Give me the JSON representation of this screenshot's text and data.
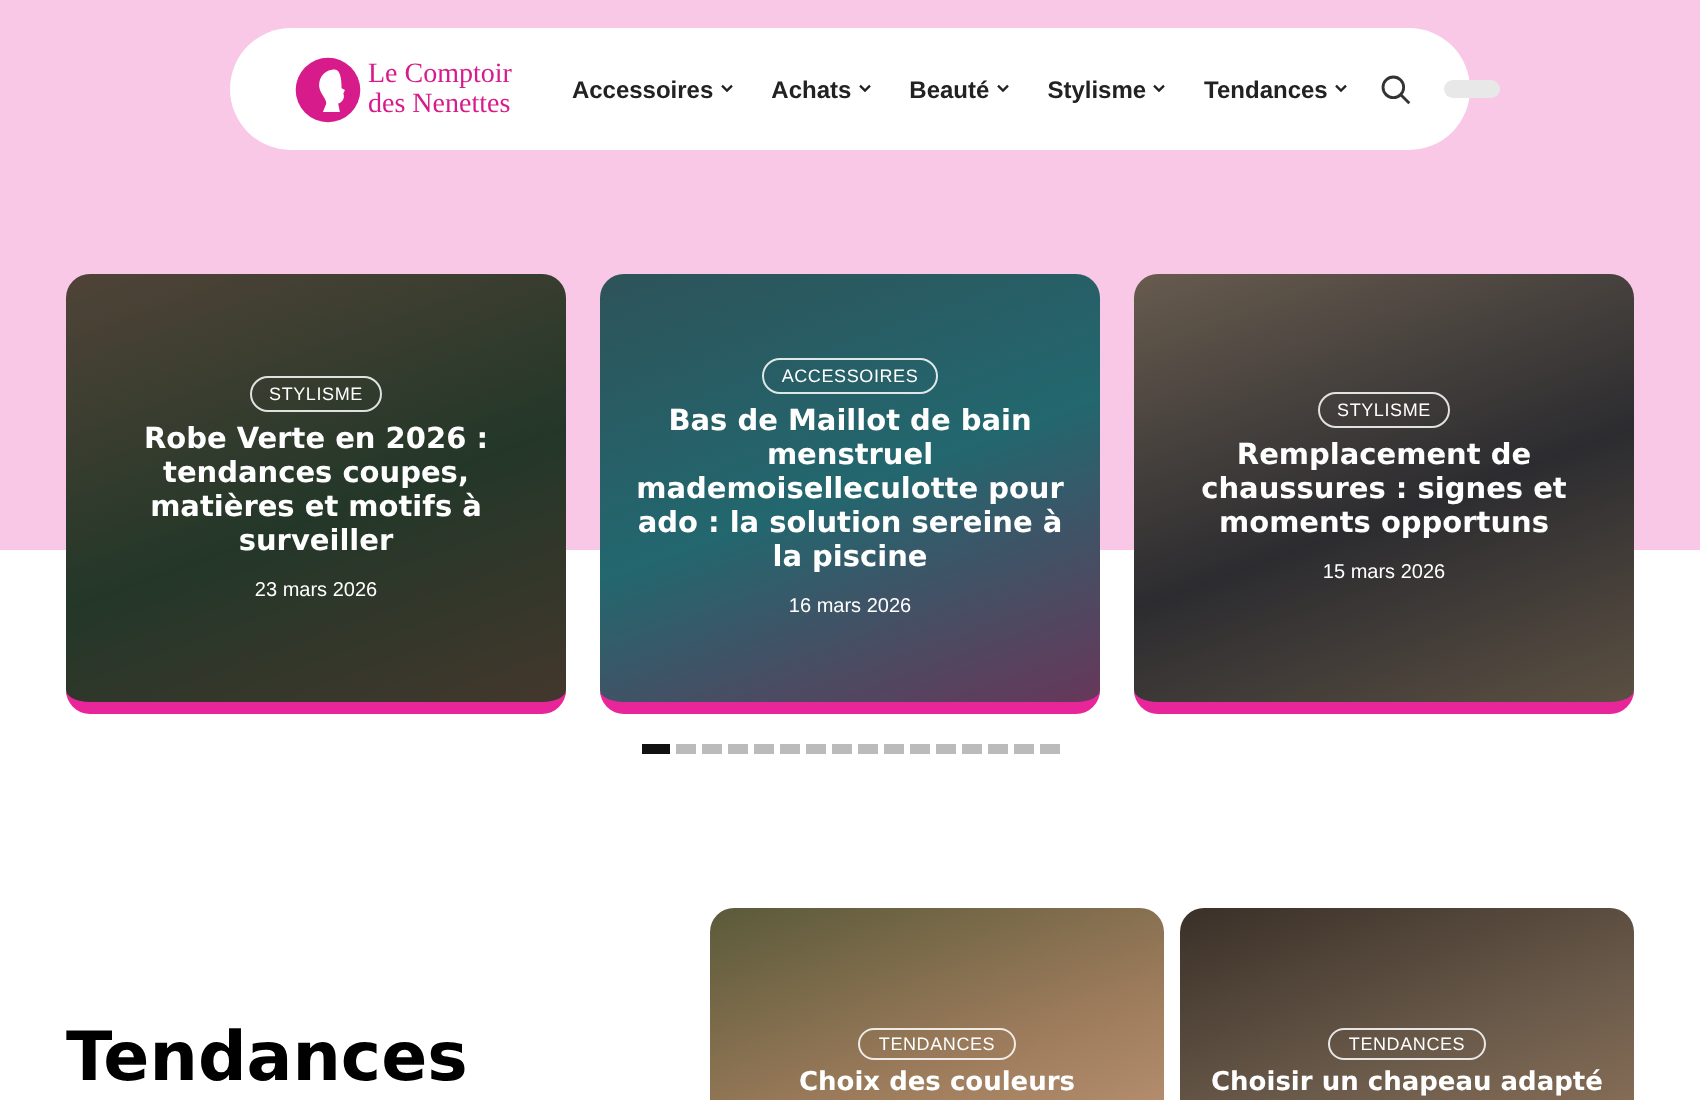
{
  "header": {
    "logo_lines": [
      "Le Comptoir",
      "des Nenettes"
    ],
    "nav": [
      {
        "label": "Accessoires"
      },
      {
        "label": "Achats"
      },
      {
        "label": "Beauté"
      },
      {
        "label": "Stylisme"
      },
      {
        "label": "Tendances"
      }
    ]
  },
  "slider": {
    "cards": [
      {
        "category": "STYLISME",
        "title": "Robe Verte en 2026 : tendances coupes, matières et motifs à surveiller",
        "date": "23 mars 2026"
      },
      {
        "category": "ACCESSOIRES",
        "title": "Bas de Maillot de bain menstruel mademoiselleculotte pour ado : la solution sereine à la piscine",
        "date": "16 mars 2026"
      },
      {
        "category": "STYLISME",
        "title": "Remplacement de chaussures : signes et moments opportuns",
        "date": "15 mars 2026"
      }
    ],
    "dots": [
      {
        "selected": true
      },
      {
        "selected": false
      },
      {
        "selected": false
      },
      {
        "selected": false
      },
      {
        "selected": false
      },
      {
        "selected": false
      },
      {
        "selected": false
      },
      {
        "selected": false
      },
      {
        "selected": false
      },
      {
        "selected": false
      },
      {
        "selected": false
      },
      {
        "selected": false
      },
      {
        "selected": false
      },
      {
        "selected": false
      },
      {
        "selected": false
      },
      {
        "selected": false
      }
    ]
  },
  "section": {
    "heading": "Tendances",
    "cards": [
      {
        "category": "TENDANCES",
        "title": "Choix des couleurs"
      },
      {
        "category": "TENDANCES",
        "title": "Choisir un chapeau adapté"
      }
    ]
  }
}
